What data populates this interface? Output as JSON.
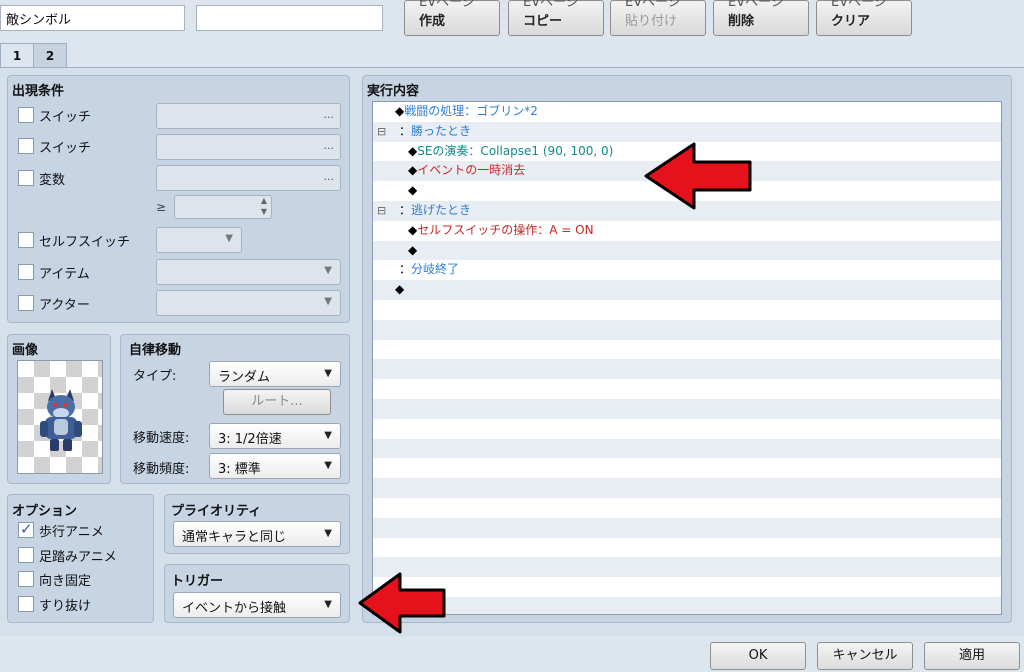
{
  "header": {
    "event_name": "敵シンボル",
    "note": "",
    "buttons": [
      {
        "line1": "EVページ",
        "line2": "作成",
        "disabled": false
      },
      {
        "line1": "EVページ",
        "line2": "コピー",
        "disabled": false
      },
      {
        "line1": "EVページ",
        "line2": "貼り付け",
        "disabled": true
      },
      {
        "line1": "EVページ",
        "line2": "削除",
        "disabled": false
      },
      {
        "line1": "EVページ",
        "line2": "クリア",
        "disabled": false
      }
    ]
  },
  "tabs": [
    "1",
    "2"
  ],
  "conditions": {
    "title": "出現条件",
    "switch1_label": "スイッチ",
    "switch2_label": "スイッチ",
    "variable_label": "変数",
    "gte": "≥",
    "self_switch_label": "セルフスイッチ",
    "item_label": "アイテム",
    "actor_label": "アクター",
    "dots": "..."
  },
  "image": {
    "title": "画像"
  },
  "autonomous": {
    "title": "自律移動",
    "type_label": "タイプ:",
    "type_value": "ランダム",
    "route_button": "ルート...",
    "speed_label": "移動速度:",
    "speed_value": "3: 1/2倍速",
    "freq_label": "移動頻度:",
    "freq_value": "3: 標準"
  },
  "options": {
    "title": "オプション",
    "walking": "歩行アニメ",
    "stepping": "足踏みアニメ",
    "direction_fix": "向き固定",
    "through": "すり抜け"
  },
  "priority": {
    "title": "プライオリティ",
    "value": "通常キャラと同じ"
  },
  "trigger": {
    "title": "トリガー",
    "value": "イベントから接触"
  },
  "contents": {
    "title": "実行内容",
    "lines": [
      {
        "prefix": "◆",
        "text": "戦闘の処理：ゴブリン*2",
        "color": "blue",
        "indent": 0,
        "fold": false
      },
      {
        "prefix": "：",
        "text": "勝ったとき",
        "color": "blue",
        "indent": 0,
        "fold": true
      },
      {
        "prefix": "◆",
        "text": "SEの演奏：Collapse1 (90, 100, 0)",
        "color": "teal",
        "indent": 1,
        "fold": false
      },
      {
        "prefix": "◆",
        "text": "イベントの一時消去",
        "color": "red",
        "indent": 1,
        "fold": false
      },
      {
        "prefix": "◆",
        "text": "",
        "color": "black",
        "indent": 1,
        "fold": false
      },
      {
        "prefix": "：",
        "text": "逃げたとき",
        "color": "blue",
        "indent": 0,
        "fold": true
      },
      {
        "prefix": "◆",
        "text": "セルフスイッチの操作：A = ON",
        "color": "red",
        "indent": 1,
        "fold": false
      },
      {
        "prefix": "◆",
        "text": "",
        "color": "black",
        "indent": 1,
        "fold": false
      },
      {
        "prefix": "：",
        "text": "分岐終了",
        "color": "blue",
        "indent": 0,
        "fold": false
      },
      {
        "prefix": "◆",
        "text": "",
        "color": "black",
        "indent": -1,
        "fold": false
      }
    ]
  },
  "footer": {
    "ok": "OK",
    "cancel": "キャンセル",
    "apply": "適用"
  },
  "colors": {
    "arrow": "#e5121b",
    "blue_text": "#2d7dd2",
    "red_text": "#c82828",
    "teal_text": "#108a8a"
  }
}
